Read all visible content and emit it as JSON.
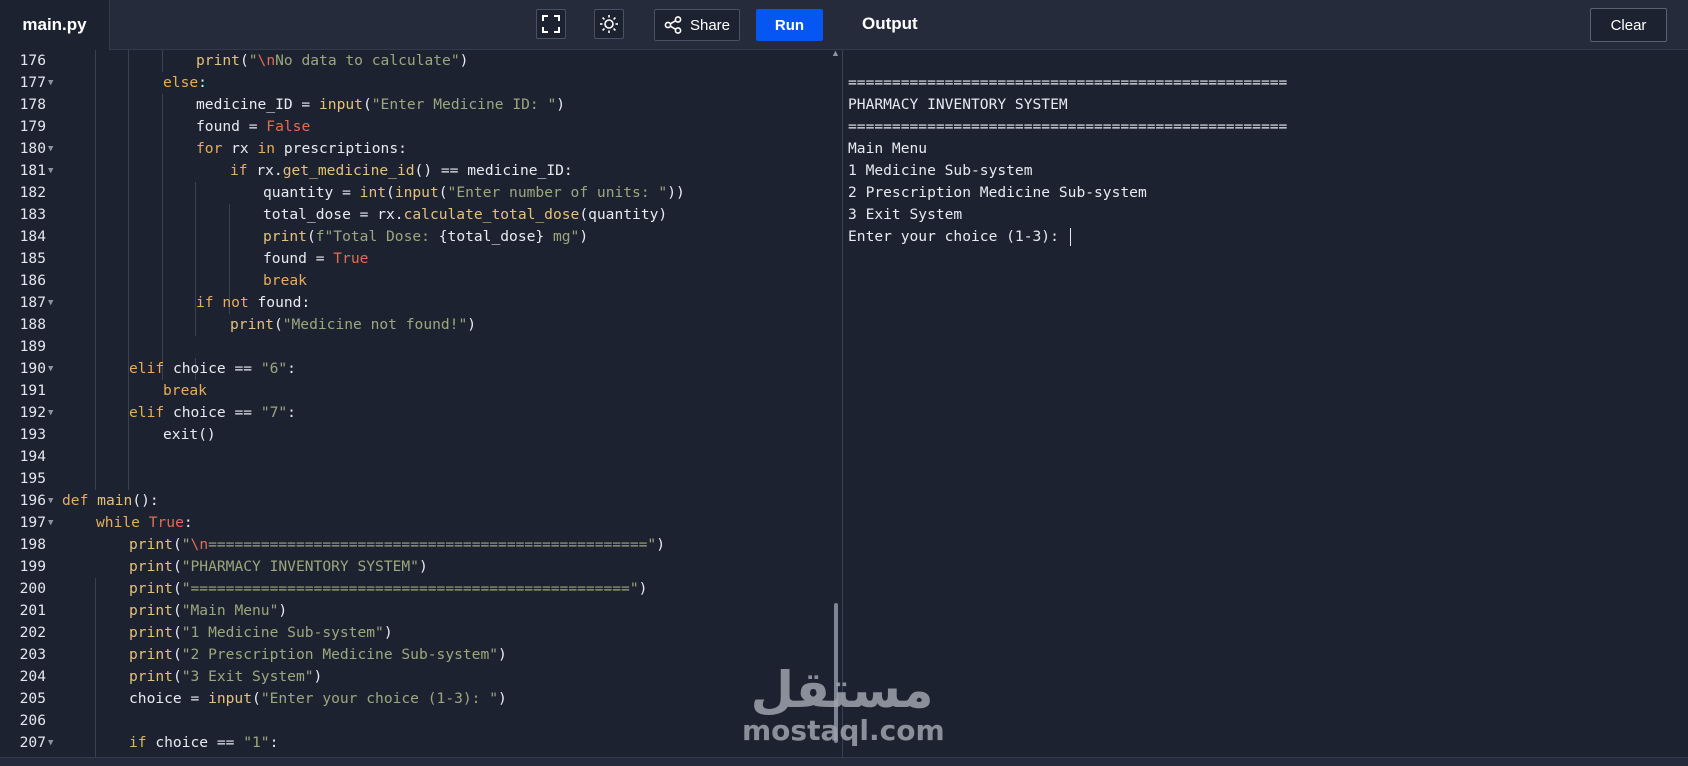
{
  "header": {
    "file_name": "main.py",
    "share_label": "Share",
    "run_label": "Run",
    "output_title": "Output",
    "clear_label": "Clear",
    "icons": [
      "fullscreen-icon",
      "theme-sun-icon",
      "share-icon"
    ]
  },
  "editor": {
    "lines": [
      {
        "n": "176",
        "fold": false
      },
      {
        "n": "177",
        "fold": true
      },
      {
        "n": "178",
        "fold": false
      },
      {
        "n": "179",
        "fold": false
      },
      {
        "n": "180",
        "fold": true
      },
      {
        "n": "181",
        "fold": true
      },
      {
        "n": "182",
        "fold": false
      },
      {
        "n": "183",
        "fold": false
      },
      {
        "n": "184",
        "fold": false
      },
      {
        "n": "185",
        "fold": false
      },
      {
        "n": "186",
        "fold": false
      },
      {
        "n": "187",
        "fold": true
      },
      {
        "n": "188",
        "fold": false
      },
      {
        "n": "189",
        "fold": false
      },
      {
        "n": "190",
        "fold": true
      },
      {
        "n": "191",
        "fold": false
      },
      {
        "n": "192",
        "fold": true
      },
      {
        "n": "193",
        "fold": false
      },
      {
        "n": "194",
        "fold": false
      },
      {
        "n": "195",
        "fold": false
      },
      {
        "n": "196",
        "fold": true
      },
      {
        "n": "197",
        "fold": true
      },
      {
        "n": "198",
        "fold": false
      },
      {
        "n": "199",
        "fold": false
      },
      {
        "n": "200",
        "fold": false
      },
      {
        "n": "201",
        "fold": false
      },
      {
        "n": "202",
        "fold": false
      },
      {
        "n": "203",
        "fold": false
      },
      {
        "n": "204",
        "fold": false
      },
      {
        "n": "205",
        "fold": false
      },
      {
        "n": "206",
        "fold": false
      },
      {
        "n": "207",
        "fold": true
      }
    ]
  },
  "output": {
    "lines": [
      "==================================================",
      "PHARMACY INVENTORY SYSTEM",
      "==================================================",
      "Main Menu",
      "1 Medicine Sub-system",
      "2 Prescription Medicine Sub-system",
      "3 Exit System",
      "Enter your choice (1-3): "
    ]
  },
  "colors": {
    "background": "#1d2230",
    "topbar": "#252b3a",
    "run_button": "#0556f3",
    "keyword": "#e7ad5a",
    "string": "#9aa87d",
    "constant": "#e06c54"
  },
  "watermark": {
    "arabic": "مستقل",
    "latin": "mostaql.com"
  }
}
